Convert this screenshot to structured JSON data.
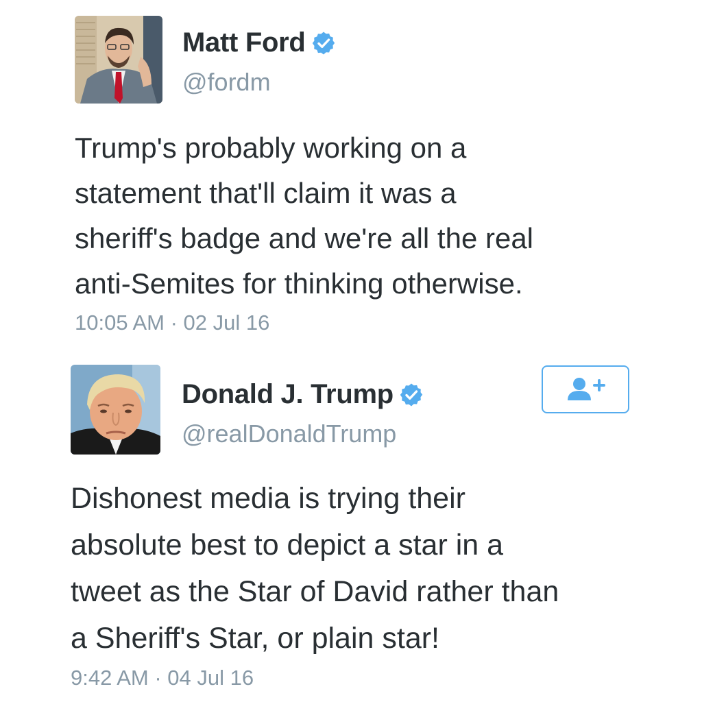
{
  "colors": {
    "verified_badge": "#55acee",
    "secondary_text": "#8899a6",
    "primary_text": "#292f33",
    "follow_button_border": "#55acee"
  },
  "tweets": [
    {
      "name": "Matt Ford",
      "handle": "@fordm",
      "verified_icon": "verified-badge-icon",
      "text_lines": [
        "Trump's probably working on a",
        "statement that'll claim it was a",
        "sheriff's badge and we're all the real",
        "anti-Semites for thinking otherwise."
      ],
      "timestamp": "10:05 AM · 02 Jul 16"
    },
    {
      "name": "Donald J. Trump",
      "handle": "@realDonaldTrump",
      "verified_icon": "verified-badge-icon",
      "follow_icon": "add-user-icon",
      "text_lines": [
        "Dishonest media is trying their",
        "absolute best to depict a star in a",
        "tweet as the Star of David rather than",
        "a Sheriff's Star, or plain star!"
      ],
      "timestamp": "9:42 AM · 04 Jul 16"
    }
  ]
}
